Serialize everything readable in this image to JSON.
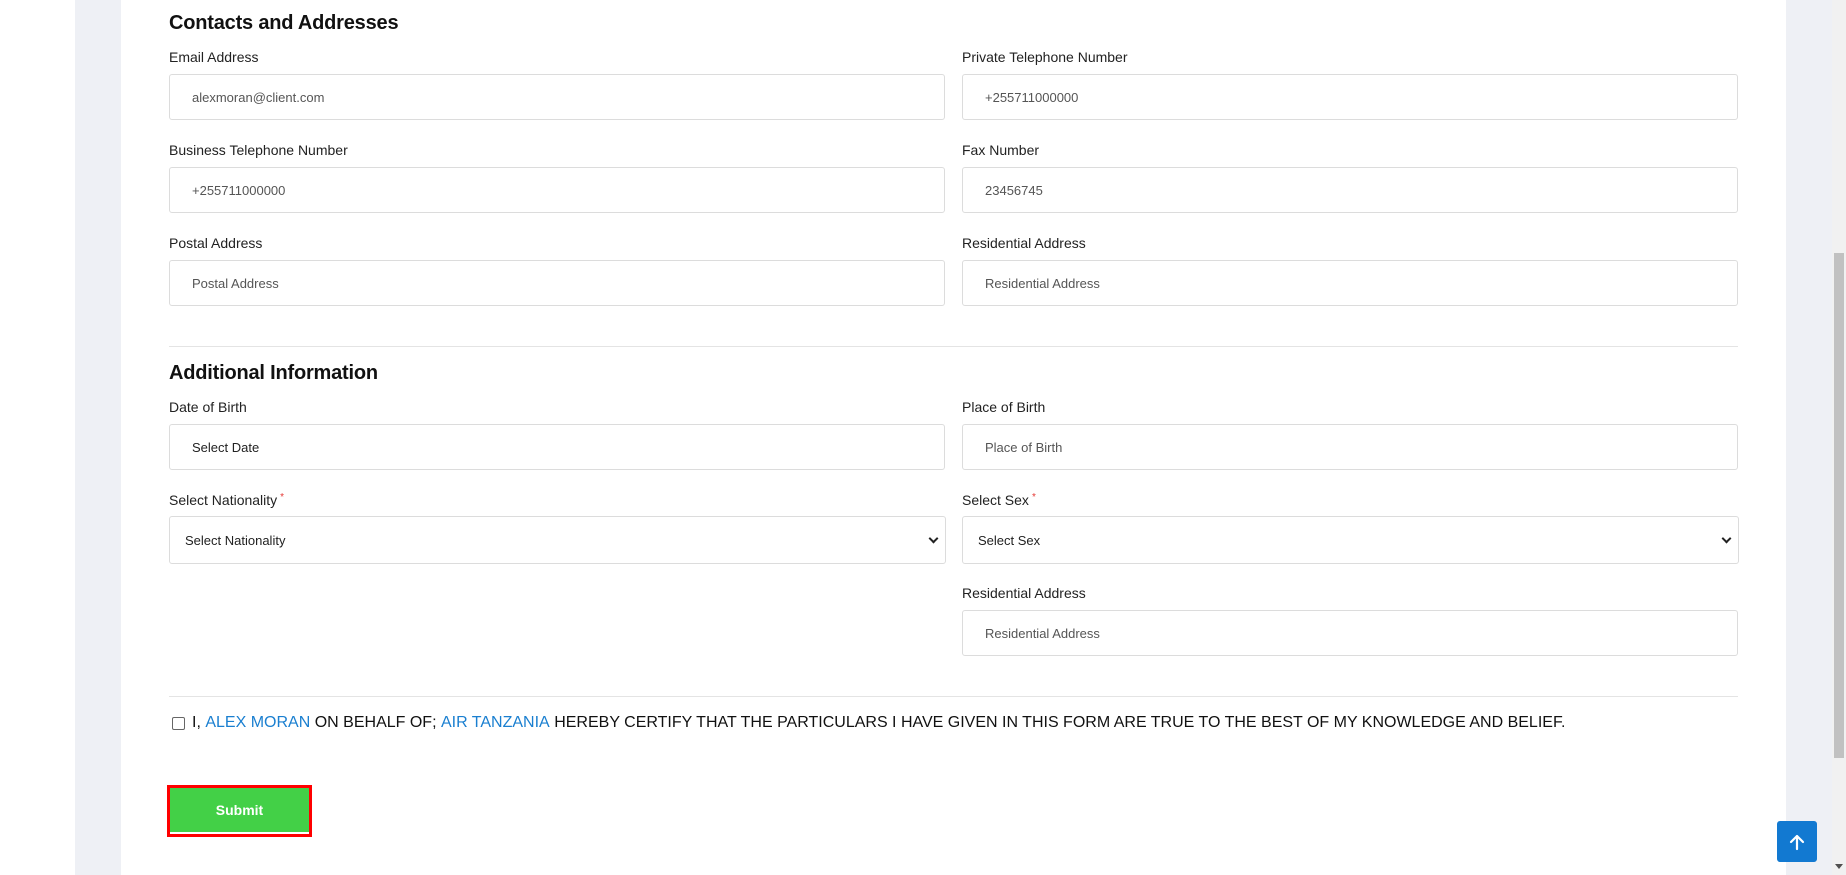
{
  "sections": {
    "contacts": {
      "title": "Contacts and Addresses",
      "email": {
        "label": "Email Address",
        "value": "alexmoran@client.com"
      },
      "private_phone": {
        "label": "Private Telephone Number",
        "value": "+255711000000"
      },
      "business_phone": {
        "label": "Business Telephone Number",
        "value": "+255711000000"
      },
      "fax": {
        "label": "Fax Number",
        "value": "23456745"
      },
      "postal_address": {
        "label": "Postal Address",
        "placeholder": "Postal Address"
      },
      "residential_address": {
        "label": "Residential Address",
        "placeholder": "Residential Address"
      }
    },
    "additional": {
      "title": "Additional Information",
      "dob": {
        "label": "Date of Birth",
        "placeholder": "Select Date"
      },
      "place_of_birth": {
        "label": "Place of Birth",
        "placeholder": "Place of Birth"
      },
      "nationality": {
        "label": "Select Nationality",
        "required_mark": "*",
        "selected": "Select Nationality"
      },
      "sex": {
        "label": "Select Sex",
        "required_mark": "*",
        "selected": "Select Sex"
      },
      "residential_address_2": {
        "label": "Residential Address",
        "placeholder": "Residential Address"
      }
    }
  },
  "certification": {
    "prefix": "I,",
    "name": "ALEX MORAN",
    "middle": "ON BEHALF OF;",
    "organization": "AIR TANZANIA",
    "suffix": "HEREBY CERTIFY THAT THE PARTICULARS I HAVE GIVEN IN THIS FORM ARE TRUE TO THE BEST OF MY KNOWLEDGE AND BELIEF.",
    "checked": false
  },
  "actions": {
    "submit_label": "Submit"
  },
  "icons": {
    "back_to_top": "arrow-up-icon"
  },
  "colors": {
    "submit": "#43d047",
    "highlight": "#ff0000",
    "link": "#1a7fd0",
    "back_to_top": "#1279d1"
  }
}
